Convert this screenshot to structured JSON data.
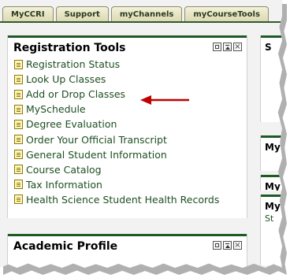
{
  "tabs": [
    "MyCCRI",
    "Support",
    "myChannels",
    "myCourseTools"
  ],
  "registration_tools": {
    "title": "Registration Tools",
    "links": [
      "Registration Status",
      "Look Up Classes",
      "Add or Drop Classes",
      "MySchedule",
      "Degree Evaluation",
      "Order Your Official Transcript",
      "General Student Information",
      "Course Catalog",
      "Tax Information",
      "Health Science Student Health Records"
    ]
  },
  "academic_profile": {
    "title": "Academic Profile"
  },
  "right_column": {
    "p1_title": "S",
    "p2_title": "My",
    "p3_title": "My",
    "p4_title": "My",
    "p4_link": "St"
  },
  "annotation": {
    "arrow_color": "#c00000"
  },
  "colors": {
    "accent": "#1d5a24",
    "link": "#1e4f22",
    "tab_bg": "#e8e5c4"
  }
}
